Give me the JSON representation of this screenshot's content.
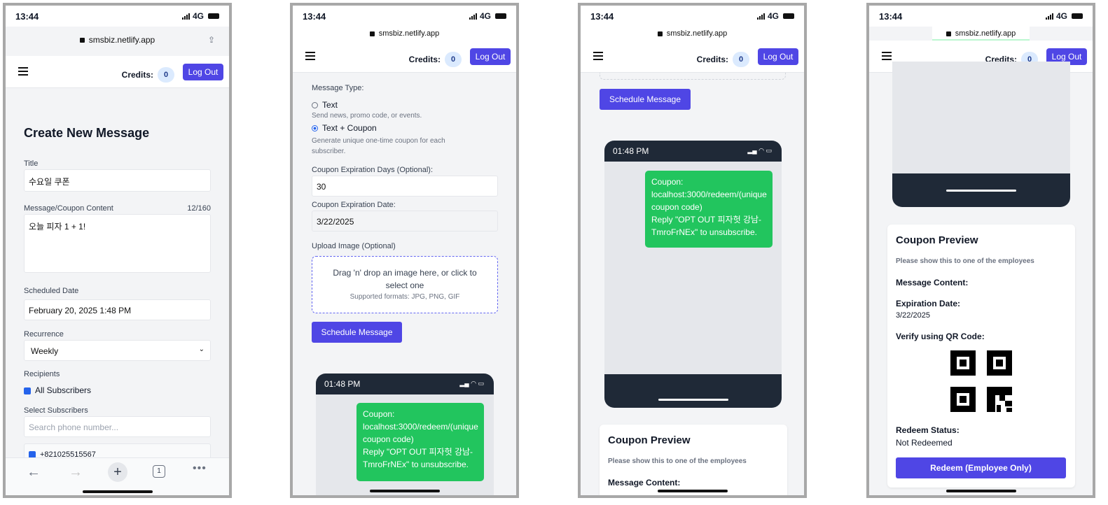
{
  "device": {
    "time": "13:44",
    "network": "4G",
    "url": "smsbiz.netlify.app"
  },
  "header": {
    "credits_label": "Credits:",
    "credits_value": "0",
    "logout_label": "Log Out"
  },
  "screen1": {
    "page_title": "Create New Message",
    "title_label": "Title",
    "title_value": "수요일 쿠폰",
    "content_label": "Message/Coupon Content",
    "content_count": "12/160",
    "content_value": "오늘 피자 1 + 1!",
    "date_label": "Scheduled Date",
    "date_value": "February 20, 2025 1:48 PM",
    "recurrence_label": "Recurrence",
    "recurrence_value": "Weekly",
    "recipients_label": "Recipients",
    "all_subscribers_label": "All Subscribers",
    "select_label": "Select Subscribers",
    "search_placeholder": "Search phone number...",
    "subscriber_phone": "+821025515567"
  },
  "screen2": {
    "type_label": "Message Type:",
    "opt_text": "Text",
    "opt_text_hint": "Send news, promo code, or events.",
    "opt_coupon": "Text + Coupon",
    "opt_coupon_hint_1": "Generate unique one-time coupon for each",
    "opt_coupon_hint_2": "subscriber.",
    "exp_days_label": "Coupon Expiration Days (Optional):",
    "exp_days_value": "30",
    "exp_date_label": "Coupon Expiration Date:",
    "exp_date_value": "3/22/2025",
    "upload_label": "Upload Image (Optional)",
    "drop_line1": "Drag 'n' drop an image here, or click to",
    "drop_line2": "select one",
    "formats": "Supported formats: JPG, PNG, GIF",
    "schedule_label": "Schedule Message"
  },
  "preview": {
    "time": "01:48 PM",
    "bubble_lines": [
      "Coupon:",
      "localhost:3000/redeem/(unique",
      "coupon code)",
      "Reply \"OPT OUT 피자헛 강남-",
      "TmroFrNEx\" to unsubscribe."
    ]
  },
  "coupon": {
    "title": "Coupon Preview",
    "subtitle": "Please show this to one of the employees",
    "message_label": "Message Content:",
    "exp_label": "Expiration Date:",
    "exp_value": "3/22/2025",
    "qr_label": "Verify using QR Code:",
    "status_label": "Redeem Status:",
    "status_value": "Not Redeemed",
    "redeem_label": "Redeem (Employee Only)"
  },
  "colors": {
    "primary": "#4f46e5",
    "bubble": "#22c55e",
    "phone_dark": "#1f2937"
  },
  "icons": [
    "back-arrow-icon",
    "forward-arrow-icon",
    "new-tab-icon",
    "tabs-count-icon",
    "more-icon",
    "share-icon",
    "lock-icon",
    "menu-icon",
    "signal-icon",
    "wifi-icon",
    "battery-icon",
    "chevron-down-icon",
    "qr-code-icon"
  ],
  "browser": {
    "tab_count": "1"
  }
}
